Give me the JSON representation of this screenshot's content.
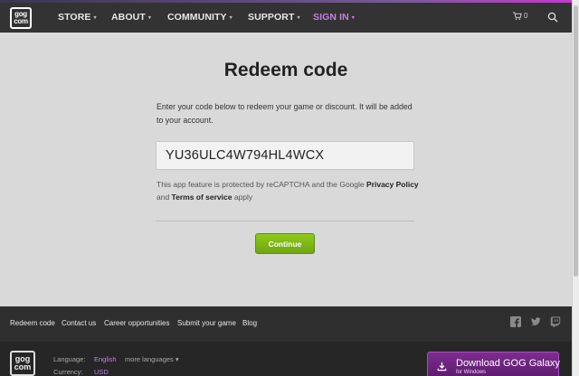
{
  "nav": {
    "logo_line1": "gog",
    "logo_line2": "com",
    "items": [
      {
        "label": "STORE"
      },
      {
        "label": "ABOUT"
      },
      {
        "label": "COMMUNITY"
      },
      {
        "label": "SUPPORT"
      },
      {
        "label": "SIGN IN"
      }
    ],
    "cart_count": "0",
    "chevron": "⌄"
  },
  "main": {
    "title": "Redeem code",
    "description": "Enter your code below to redeem your game or discount. It will be added to your account.",
    "code_value": "YU36ULC4W794HL4WCX",
    "recaptcha_prefix": "This app feature is protected by reCAPTCHA and the Google ",
    "privacy_link": "Privacy Policy",
    "and_text": " and ",
    "terms_link": "Terms of service",
    "apply_text": " apply",
    "continue_label": "Continue"
  },
  "footer": {
    "links": [
      "Redeem code",
      "Contact us",
      "Career opportunities",
      "Submit your game",
      "Blog"
    ],
    "social_icons": [
      "facebook-icon",
      "twitter-icon",
      "twitch-icon"
    ],
    "language_label": "Language:",
    "language_value": "English",
    "more_languages": "more languages",
    "currency_label": "Currency:",
    "currency_value": "USD",
    "galaxy_main": "Download GOG Galaxy",
    "galaxy_sub": "for Windows"
  },
  "colors": {
    "nav_bg": "#333333",
    "accent_purple": "#c77ee0",
    "continue_green": "#7bb814",
    "galaxy_purple": "#6d2380"
  }
}
